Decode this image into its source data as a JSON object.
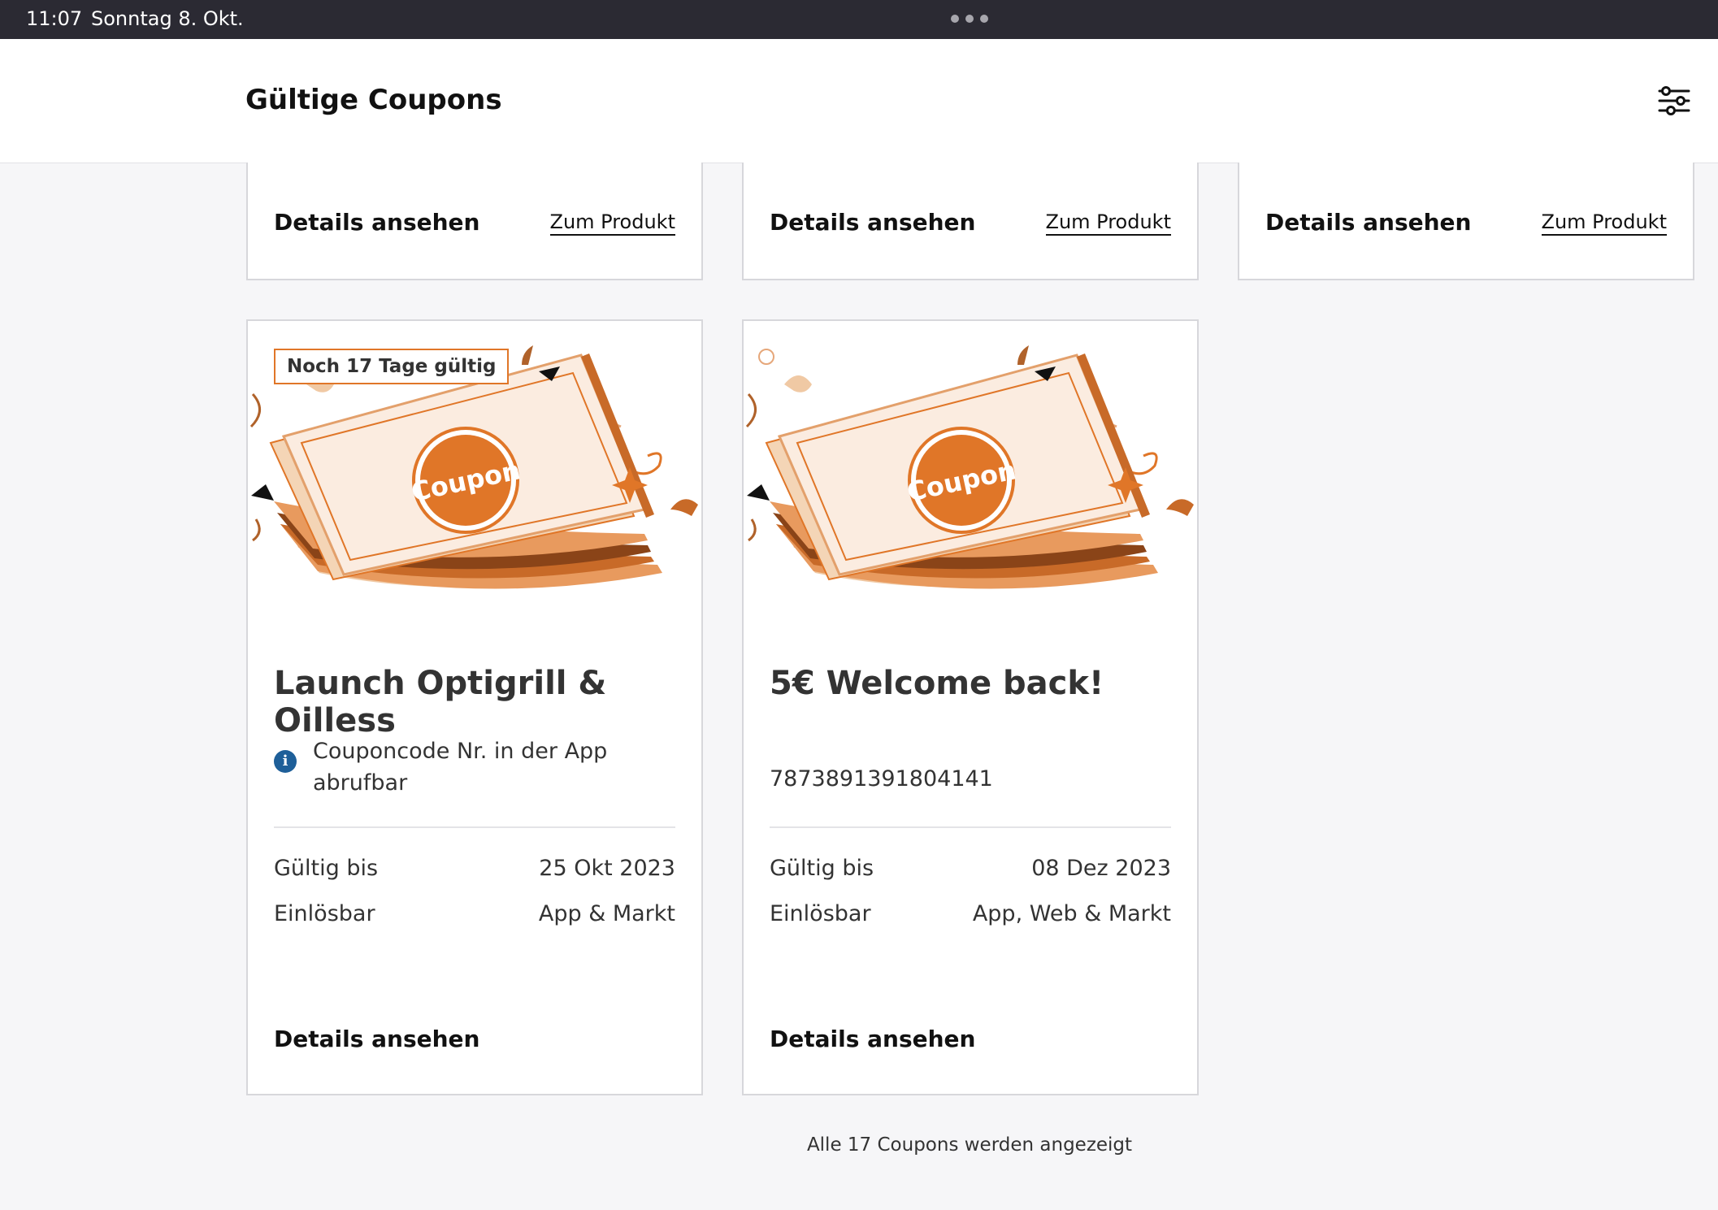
{
  "status_bar": {
    "time": "11:07",
    "date": "Sonntag 8. Okt."
  },
  "header": {
    "title": "Gültige Coupons",
    "filter_icon": "sliders-icon"
  },
  "top_cards": [
    {
      "details_label": "Details ansehen",
      "product_label": "Zum Produkt"
    },
    {
      "details_label": "Details ansehen",
      "product_label": "Zum Produkt"
    },
    {
      "details_label": "Details ansehen",
      "product_label": "Zum Produkt"
    }
  ],
  "coupons": [
    {
      "badge": "Noch 17 Tage gültig",
      "image_text": "Coupon",
      "title": "Launch Optigrill & Oilless",
      "info_text": "Couponcode Nr. in der App abrufbar",
      "valid_label": "Gültig bis",
      "valid_value": "25 Okt 2023",
      "redeem_label": "Einlösbar",
      "redeem_value": "App & Markt",
      "details_label": "Details ansehen"
    },
    {
      "image_text": "Coupon",
      "title": "5€ Welcome back!",
      "code": "7873891391804141",
      "valid_label": "Gültig bis",
      "valid_value": "08 Dez 2023",
      "redeem_label": "Einlösbar",
      "redeem_value": "App, Web & Markt",
      "details_label": "Details ansehen"
    }
  ],
  "footer": {
    "text": "Alle 17 Coupons werden angezeigt"
  },
  "colors": {
    "accent": "#e07628",
    "info_blue": "#1e5f99",
    "status_bar": "#2b2a33"
  }
}
